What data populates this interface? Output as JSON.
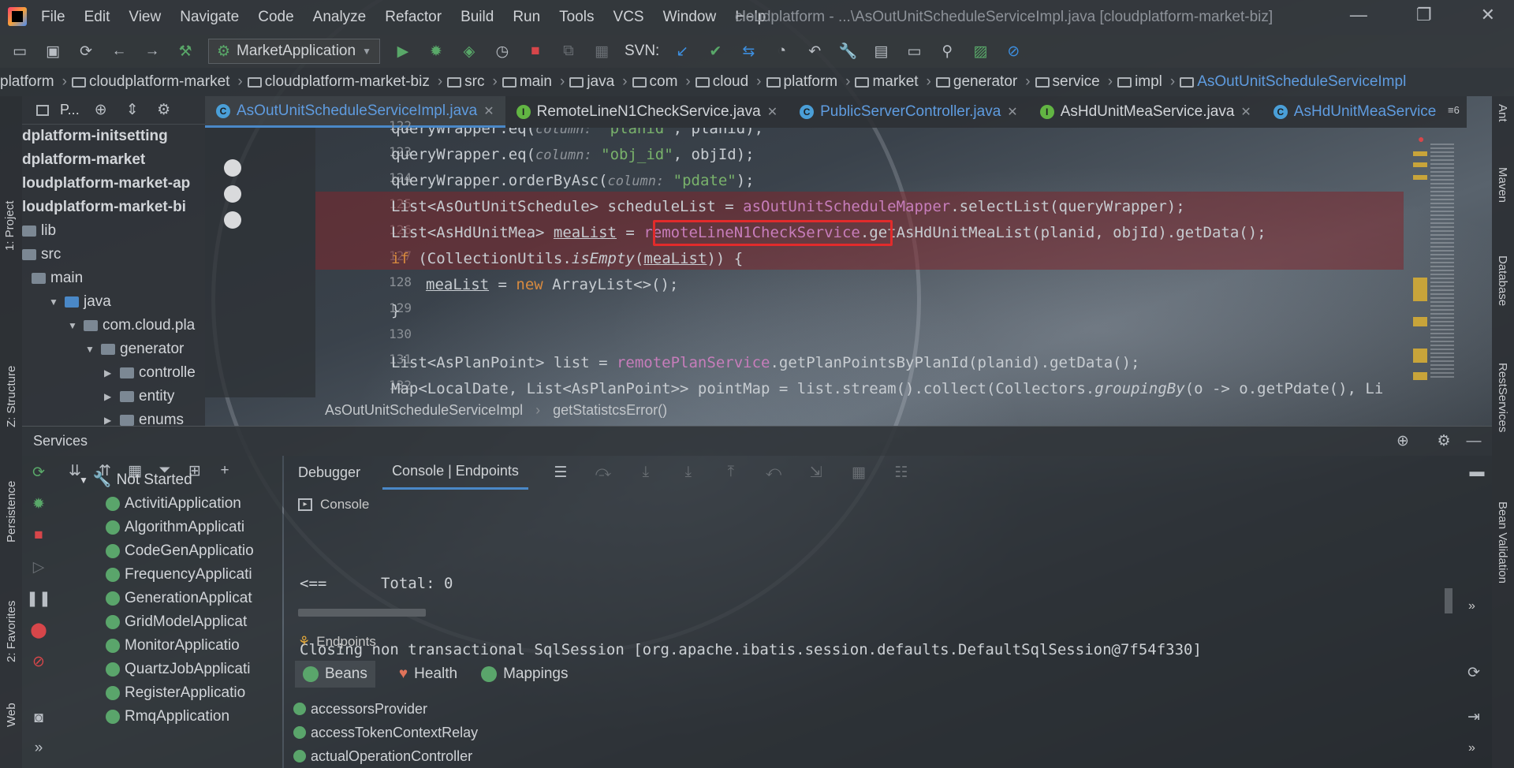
{
  "menu": [
    "File",
    "Edit",
    "View",
    "Navigate",
    "Code",
    "Analyze",
    "Refactor",
    "Build",
    "Run",
    "Tools",
    "VCS",
    "Window",
    "Help"
  ],
  "window_title": "cloudplatform - ...\\AsOutUnitScheduleServiceImpl.java [cloudplatform-market-biz]",
  "window_controls": {
    "minimize": "—",
    "restore": "❐",
    "close": "✕"
  },
  "toolbar": {
    "run_config": "MarketApplication",
    "svn_label": "SVN:"
  },
  "breadcrumb": [
    "platform",
    "cloudplatform-market",
    "cloudplatform-market-biz",
    "src",
    "main",
    "java",
    "com",
    "cloud",
    "platform",
    "market",
    "generator",
    "service",
    "impl",
    "AsOutUnitScheduleServiceImpl"
  ],
  "left_stripe": {
    "project": "1: Project",
    "structure": "Z: Structure",
    "persistence": "Persistence",
    "favorites": "2: Favorites",
    "web": "Web"
  },
  "right_stripe": {
    "ant": "Ant",
    "maven": "Maven",
    "database": "Database",
    "rest": "RestServices",
    "bean": "Bean Validation"
  },
  "project_panel": {
    "title": "P...",
    "items": [
      {
        "label": "dplatform-initsetting",
        "bold": true
      },
      {
        "label": "dplatform-market",
        "bold": true
      },
      {
        "label": "loudplatform-market-ap",
        "bold": true
      },
      {
        "label": "loudplatform-market-bi",
        "bold": true
      },
      {
        "label": "lib"
      },
      {
        "label": "src"
      },
      {
        "label": "main"
      },
      {
        "label": "java"
      },
      {
        "label": "com.cloud.pla"
      },
      {
        "label": "generator"
      },
      {
        "label": "controlle"
      },
      {
        "label": "entity"
      },
      {
        "label": "enums"
      }
    ]
  },
  "editor_tabs": [
    {
      "label": "AsOutUnitScheduleServiceImpl.java",
      "icon": "C",
      "active": true,
      "closable": true
    },
    {
      "label": "RemoteLineN1CheckService.java",
      "icon": "I",
      "closable": true
    },
    {
      "label": "PublicServerController.java",
      "icon": "C",
      "closable": true
    },
    {
      "label": "AsHdUnitMeaService.java",
      "icon": "I",
      "closable": true
    },
    {
      "label": "AsHdUnitMeaService",
      "icon": "C"
    }
  ],
  "tab_overflow": "≡6",
  "line_numbers": [
    "122",
    "123",
    "124",
    "125",
    "126",
    "127",
    "128",
    "129",
    "130",
    "131",
    "132"
  ],
  "code": {
    "l122a": "queryWrapper.eq(",
    "l122h": "column:",
    "l122s": "\"planid\"",
    "l122b": ", planid);",
    "l123a": "queryWrapper.eq(",
    "l123h": "column:",
    "l123s": "\"obj_id\"",
    "l123b": ", objId);",
    "l124a": "queryWrapper.orderByAsc(",
    "l124h": "column:",
    "l124s": "\"pdate\"",
    "l124b": ");",
    "l125a": "List<AsOutUnitSchedule> scheduleList = ",
    "l125f": "asOutUnitScheduleMapper",
    "l125b": ".selectList(queryWrapper);",
    "l126a": "List<AsHdUnitMea> ",
    "l126v": "meaList",
    "l126e": " = ",
    "l126f": "remoteLineN1CheckService",
    "l126b": ".getAsHdUnitMeaList(planid, objId).getData();",
    "l127k": "if",
    "l127a": " (CollectionUtils.",
    "l127i": "isEmpty",
    "l127p": "(",
    "l127v": "meaList",
    "l127b": ")) {",
    "l128v": "meaList",
    "l128a": " = ",
    "l128k": "new",
    "l128b": " ArrayList<>();",
    "l129": "}",
    "l131a": "List<AsPlanPoint> list = ",
    "l131f": "remotePlanService",
    "l131b": ".getPlanPointsByPlanId(planid).getData();",
    "l132a": "Map<LocalDate, List<AsPlanPoint>> pointMap = list.stream().collect(Collectors.",
    "l132i": "groupingBy",
    "l132b": "(o -> o.getPdate(), Li"
  },
  "editor_breadcrumb": {
    "class": "AsOutUnitScheduleServiceImpl",
    "method": "getStatistcsError()"
  },
  "services": {
    "title": "Services",
    "group": "Not Started",
    "apps": [
      "ActivitiApplication",
      "AlgorithmApplicati",
      "CodeGenApplicatio",
      "FrequencyApplicati",
      "GenerationApplicat",
      "GridModelApplicat",
      "MonitorApplicatio",
      "QuartzJobApplicati",
      "RegisterApplicatio",
      "RmqApplication"
    ],
    "subtabs": [
      "Debugger",
      "Console | Endpoints"
    ],
    "console_label": "Console",
    "console_lines": [
      "<==      Total: 0",
      "Closing non transactional SqlSession [org.apache.ibatis.session.defaults.DefaultSqlSession@7f54f330]"
    ],
    "endpoints_label": "Endpoints",
    "endpoint_tabs": [
      "Beans",
      "Health",
      "Mappings"
    ],
    "beans": [
      "accessorsProvider",
      "accessTokenContextRelay",
      "actualOperationController"
    ]
  }
}
